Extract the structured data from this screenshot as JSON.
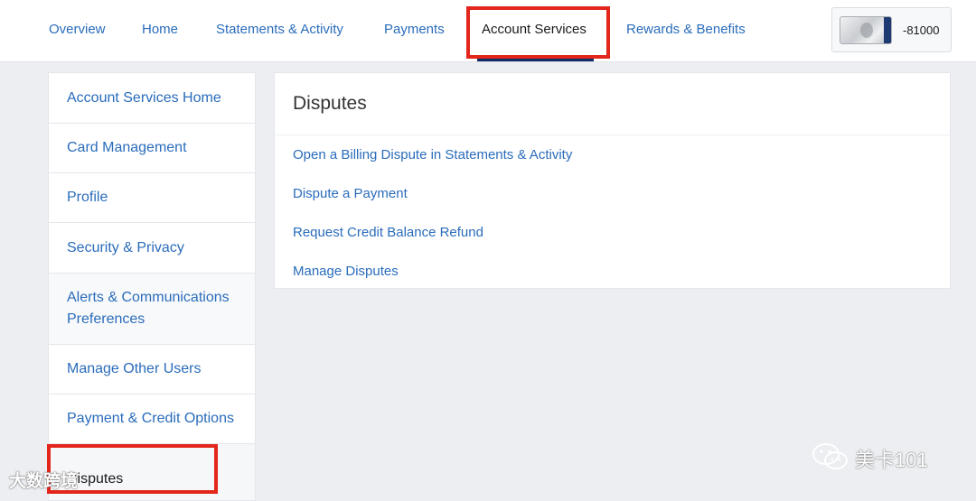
{
  "nav": {
    "tabs": [
      {
        "label": "Overview"
      },
      {
        "label": "Home"
      },
      {
        "label": "Statements & Activity"
      },
      {
        "label": "Payments"
      },
      {
        "label": "Account Services"
      },
      {
        "label": "Rewards & Benefits"
      }
    ],
    "active_tab": "Account Services",
    "card": {
      "icon": "amex-platinum-card-icon",
      "number_suffix": "-81000"
    }
  },
  "sidebar": {
    "items": [
      {
        "label": "Account Services Home"
      },
      {
        "label": "Card Management"
      },
      {
        "label": "Profile"
      },
      {
        "label": "Security & Privacy"
      },
      {
        "label": "Alerts & Communications Preferences"
      },
      {
        "label": "Manage Other Users"
      },
      {
        "label": "Payment & Credit Options"
      },
      {
        "label": "Disputes"
      }
    ],
    "active_item": "Disputes"
  },
  "main": {
    "title": "Disputes",
    "links": [
      {
        "label": "Open a Billing Dispute in Statements & Activity"
      },
      {
        "label": "Dispute a Payment"
      },
      {
        "label": "Request Credit Balance Refund"
      },
      {
        "label": "Manage Disputes"
      }
    ]
  },
  "watermarks": {
    "left": "大数跨境",
    "right": "美卡101",
    "right_icon": "wechat-icon"
  },
  "colors": {
    "link": "#2a6cbb",
    "highlight": "#e3261c",
    "active_underline": "#0b2e6b"
  }
}
